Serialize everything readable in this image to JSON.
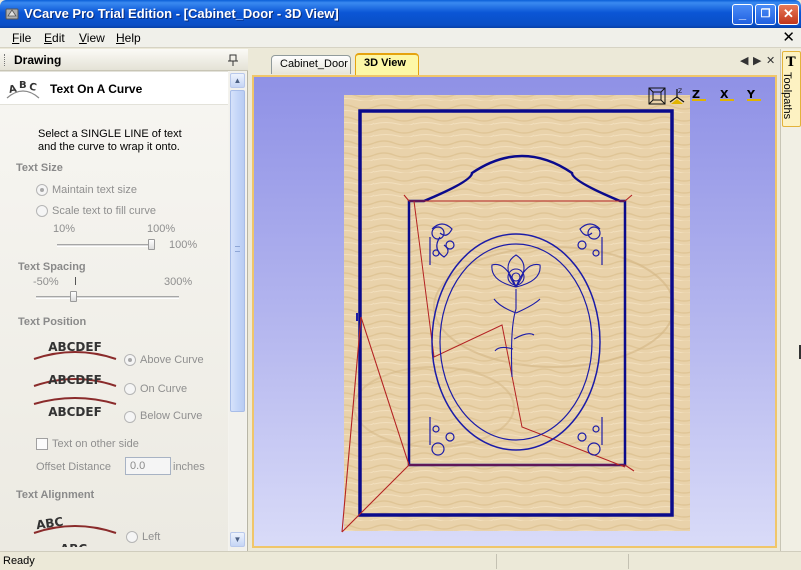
{
  "window": {
    "title": "VCarve Pro Trial Edition - [Cabinet_Door - 3D View]",
    "buttons": {
      "minimize": "_",
      "restore": "❐",
      "close": "✕"
    }
  },
  "menu": {
    "items": [
      "File",
      "Edit",
      "View",
      "Help"
    ],
    "close_glyph": "✕"
  },
  "left_panel": {
    "title": "Drawing",
    "pin": "🖈",
    "tool": {
      "icon_text": "ABC",
      "name": "Text On A Curve"
    },
    "instructions": [
      "Select a SINGLE LINE of text",
      "and the curve to wrap it onto."
    ],
    "text_size": {
      "heading": "Text Size",
      "options": [
        {
          "label": "Maintain text size",
          "selected": true
        },
        {
          "label": "Scale text to fill curve",
          "selected": false
        }
      ],
      "range_min": "10%",
      "range_max": "100%",
      "value": "100%",
      "fraction": 1.0
    },
    "text_spacing": {
      "heading": "Text Spacing",
      "range_min": "-50%",
      "range_max": "300%",
      "fraction": 0.25
    },
    "text_position": {
      "heading": "Text Position",
      "sample": "ABCDEF",
      "options": [
        {
          "label": "Above Curve",
          "selected": true
        },
        {
          "label": "On Curve",
          "selected": false
        },
        {
          "label": "Below Curve",
          "selected": false
        }
      ],
      "other_side_label": "Text on other side",
      "other_side_checked": false,
      "offset_label": "Offset Distance",
      "offset_value": "0.0",
      "offset_unit": "inches"
    },
    "text_alignment": {
      "heading": "Text Alignment",
      "sample": "ABC",
      "options": [
        {
          "label": "Left",
          "selected": false
        }
      ]
    },
    "scroll": {
      "up": "▲",
      "down": "▼"
    }
  },
  "document": {
    "tabs": [
      {
        "label": "Cabinet_Door",
        "active": false
      },
      {
        "label": "3D View",
        "active": true
      }
    ],
    "nav": {
      "prev": "◀",
      "next": "▶",
      "close": "✕"
    },
    "view_buttons": [
      "Z",
      "X",
      "Y"
    ],
    "view_axis_label": "Z",
    "colors": {
      "door_wood": "#e9d2aa",
      "frame": "#0a0a8c",
      "toolpath": "#b42323",
      "background_top": "#8f91e6"
    }
  },
  "right_strip": {
    "tab_label": "Toolpaths",
    "icon": "T"
  },
  "status": {
    "text": "Ready"
  }
}
